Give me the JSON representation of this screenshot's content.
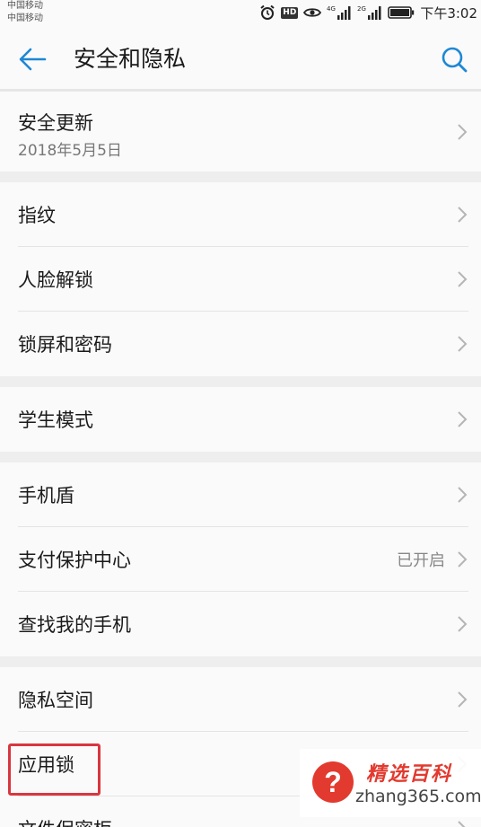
{
  "status_bar": {
    "carrier_1": "中国移动",
    "carrier_2": "中国移动",
    "hd": "HD",
    "net_1": "4G",
    "net_2": "2G",
    "time": "下午3:02"
  },
  "header": {
    "title": "安全和隐私",
    "icons": {
      "back": "arrow-left",
      "search": "search"
    },
    "accent_color": "#1e88d4"
  },
  "groups": [
    {
      "items": [
        {
          "label": "安全更新",
          "sub": "2018年5月5日"
        }
      ]
    },
    {
      "items": [
        {
          "label": "指纹"
        },
        {
          "label": "人脸解锁"
        },
        {
          "label": "锁屏和密码"
        }
      ]
    },
    {
      "items": [
        {
          "label": "学生模式"
        }
      ]
    },
    {
      "items": [
        {
          "label": "手机盾"
        },
        {
          "label": "支付保护中心",
          "value": "已开启"
        },
        {
          "label": "查找我的手机"
        }
      ]
    },
    {
      "items": [
        {
          "label": "隐私空间"
        },
        {
          "label": "应用锁"
        },
        {
          "label": "文件保密柜"
        }
      ]
    }
  ],
  "watermark": {
    "symbol": "?",
    "name": "精选百科",
    "site": "zhang365.com"
  }
}
